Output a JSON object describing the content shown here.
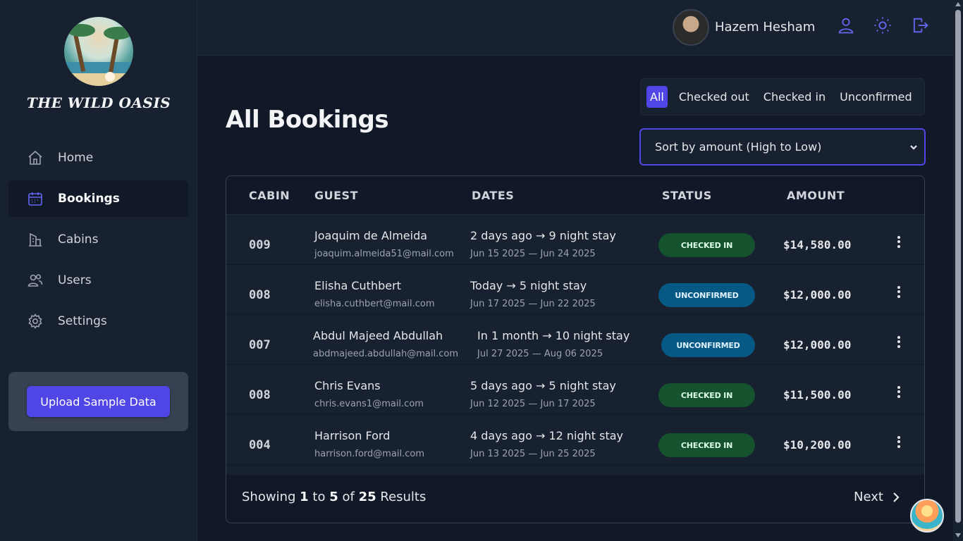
{
  "app": {
    "name": "THE WILD OASIS"
  },
  "sidebar": {
    "items": [
      {
        "label": "Home",
        "icon": "home-icon"
      },
      {
        "label": "Bookings",
        "icon": "calendar-icon",
        "active": true
      },
      {
        "label": "Cabins",
        "icon": "building-icon"
      },
      {
        "label": "Users",
        "icon": "users-icon"
      },
      {
        "label": "Settings",
        "icon": "gear-icon"
      }
    ],
    "upload_label": "Upload Sample Data"
  },
  "header": {
    "username": "Hazem Hesham",
    "icons": [
      "user-icon",
      "sun-icon",
      "logout-icon"
    ]
  },
  "main": {
    "title": "All Bookings",
    "filters": [
      "All",
      "Checked out",
      "Checked in",
      "Unconfirmed"
    ],
    "active_filter": "All",
    "sort_value": "Sort by amount (High to Low)",
    "columns": [
      "CABIN",
      "GUEST",
      "DATES",
      "STATUS",
      "AMOUNT"
    ],
    "rows": [
      {
        "cabin": "009",
        "name": "Joaquim de Almeida",
        "email": "joaquim.almeida51@mail.com",
        "dates": "2 days ago → 9 night stay",
        "range": "Jun 15 2025 — Jun 24 2025",
        "status": "CHECKED IN",
        "amount": "$14,580.00"
      },
      {
        "cabin": "008",
        "name": "Elisha Cuthbert",
        "email": "elisha.cuthbert@mail.com",
        "dates": "Today → 5 night stay",
        "range": "Jun 17 2025 — Jun 22 2025",
        "status": "UNCONFIRMED",
        "amount": "$12,000.00"
      },
      {
        "cabin": "007",
        "name": "Abdul Majeed Abdullah",
        "email": "abdmajeed.abdullah@mail.com",
        "dates": "In 1 month → 10 night stay",
        "range": "Jul 27 2025 — Aug 06 2025",
        "status": "UNCONFIRMED",
        "amount": "$12,000.00"
      },
      {
        "cabin": "008",
        "name": "Chris Evans",
        "email": "chris.evans1@mail.com",
        "dates": "5 days ago → 5 night stay",
        "range": "Jun 12 2025 — Jun 17 2025",
        "status": "CHECKED IN",
        "amount": "$11,500.00"
      },
      {
        "cabin": "004",
        "name": "Harrison Ford",
        "email": "harrison.ford@mail.com",
        "dates": "4 days ago → 12 night stay",
        "range": "Jun 13 2025 — Jun 25 2025",
        "status": "CHECKED IN",
        "amount": "$10,200.00"
      }
    ],
    "pagination": {
      "showing_word": "Showing",
      "from": "1",
      "to_word": "to",
      "to": "5",
      "of_word": "of",
      "total": "25",
      "results_word": "Results",
      "next_label": "Next"
    }
  },
  "colors": {
    "accent": "#4f46e5",
    "bg": "#111827",
    "panel": "#18212f",
    "checked_in": "#14532d",
    "unconfirmed": "#075985"
  }
}
